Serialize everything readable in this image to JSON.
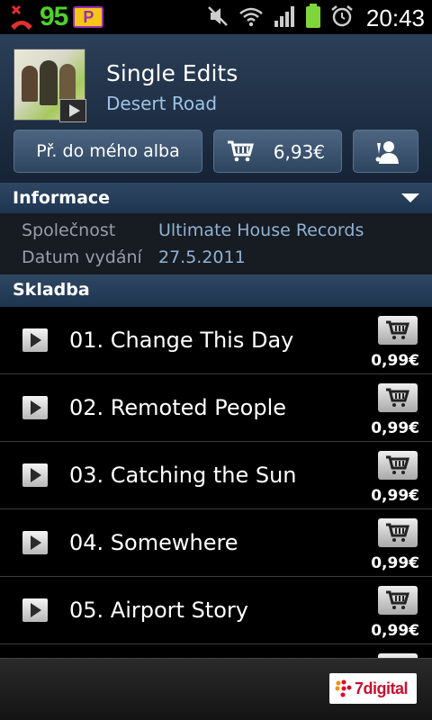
{
  "status_bar": {
    "battery_level": "95",
    "parking_badge": "P",
    "time": "20:43",
    "icons": [
      "missed-call-icon",
      "parking-icon",
      "mute-icon",
      "wifi-icon",
      "signal-icon",
      "battery-icon",
      "alarm-icon"
    ],
    "accent_green": "#4fd12b"
  },
  "album": {
    "title": "Single Edits",
    "artist": "Desert Road"
  },
  "actions": {
    "add_to_album_label": "Př. do mého alba",
    "buy_price": "6,93€"
  },
  "info_section": {
    "title": "Informace",
    "rows": [
      {
        "label": "Společnost",
        "value": "Ultimate House Records"
      },
      {
        "label": "Datum vydání",
        "value": "27.5.2011"
      }
    ]
  },
  "track_section": {
    "title": "Skladba"
  },
  "tracks": [
    {
      "name": "01. Change This Day",
      "price": "0,99€"
    },
    {
      "name": "02. Remoted People",
      "price": "0,99€"
    },
    {
      "name": "03. Catching the Sun",
      "price": "0,99€"
    },
    {
      "name": "04. Somewhere",
      "price": "0,99€"
    },
    {
      "name": "05. Airport Story",
      "price": "0,99€"
    }
  ],
  "footer": {
    "logo_text": "7digital"
  }
}
